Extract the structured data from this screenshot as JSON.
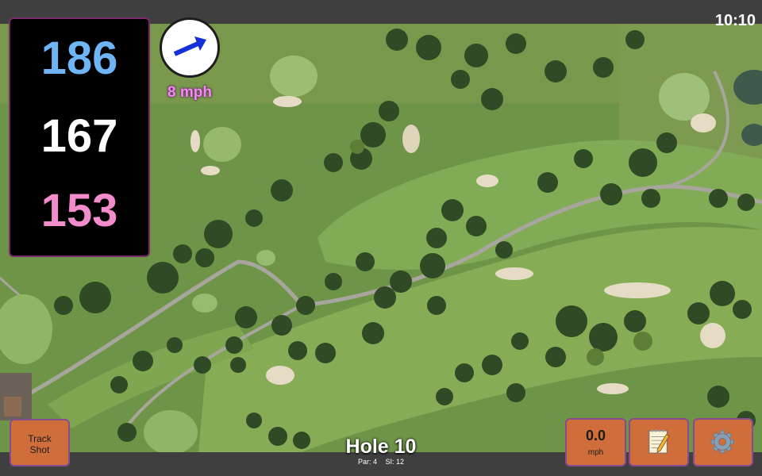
{
  "status": {
    "time": "10:10"
  },
  "distances": {
    "back": "186",
    "middle": "167",
    "front": "153",
    "back_color": "#6fb4f5",
    "middle_color": "#ffffff",
    "front_color": "#f28ccd"
  },
  "wind": {
    "speed": "8 mph",
    "icon": "wind-direction-arrow-icon",
    "arrow_color": "#1530d8"
  },
  "hole": {
    "title": "Hole 10",
    "par": "Par: 4",
    "stroke_index": "SI: 12"
  },
  "buttons": {
    "track_shot": [
      "Track",
      "Shot"
    ],
    "speed_value": "0.0",
    "speed_unit": "mph",
    "notes_icon": "notepad-icon",
    "settings_icon": "gear-icon"
  },
  "colors": {
    "button": "#cf6e3b",
    "button_border": "#8a4a90",
    "bars": "#3f3f3f"
  }
}
